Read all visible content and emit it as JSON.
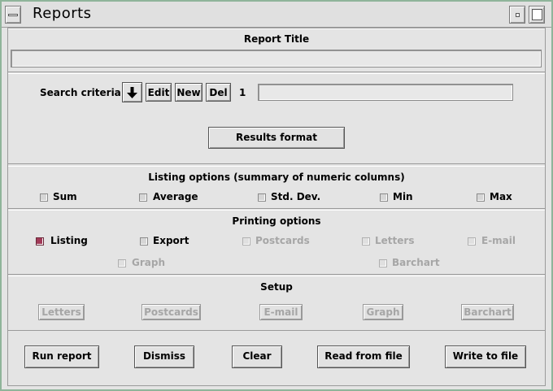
{
  "window": {
    "title": "Reports"
  },
  "report_title": {
    "label": "Report Title",
    "value": ""
  },
  "search": {
    "label": "Search criteria:",
    "edit": "Edit",
    "new": "New",
    "del": "Del",
    "index": "1",
    "value": ""
  },
  "results_format": "Results format",
  "listing_options": {
    "header": "Listing options (summary of numeric columns)",
    "items": [
      {
        "label": "Sum",
        "checked": false
      },
      {
        "label": "Average",
        "checked": false
      },
      {
        "label": "Std. Dev.",
        "checked": false
      },
      {
        "label": "Min",
        "checked": false
      },
      {
        "label": "Max",
        "checked": false
      }
    ]
  },
  "printing_options": {
    "header": "Printing options",
    "items": [
      {
        "label": "Listing",
        "checked": true,
        "enabled": true
      },
      {
        "label": "Export",
        "checked": false,
        "enabled": true
      },
      {
        "label": "Postcards",
        "checked": false,
        "enabled": false
      },
      {
        "label": "Letters",
        "checked": false,
        "enabled": false
      },
      {
        "label": "E-mail",
        "checked": false,
        "enabled": false
      },
      {
        "label": "Graph",
        "checked": false,
        "enabled": false
      },
      {
        "label": "Barchart",
        "checked": false,
        "enabled": false
      }
    ]
  },
  "setup": {
    "header": "Setup",
    "buttons": [
      "Letters",
      "Postcards",
      "E-mail",
      "Graph",
      "Barchart"
    ]
  },
  "actions": [
    "Run report",
    "Dismiss",
    "Clear",
    "Read from file",
    "Write to file"
  ],
  "colors": {
    "checked": "#a23a58",
    "window_border": "#8fb49a",
    "background": "#e4e4e4"
  }
}
